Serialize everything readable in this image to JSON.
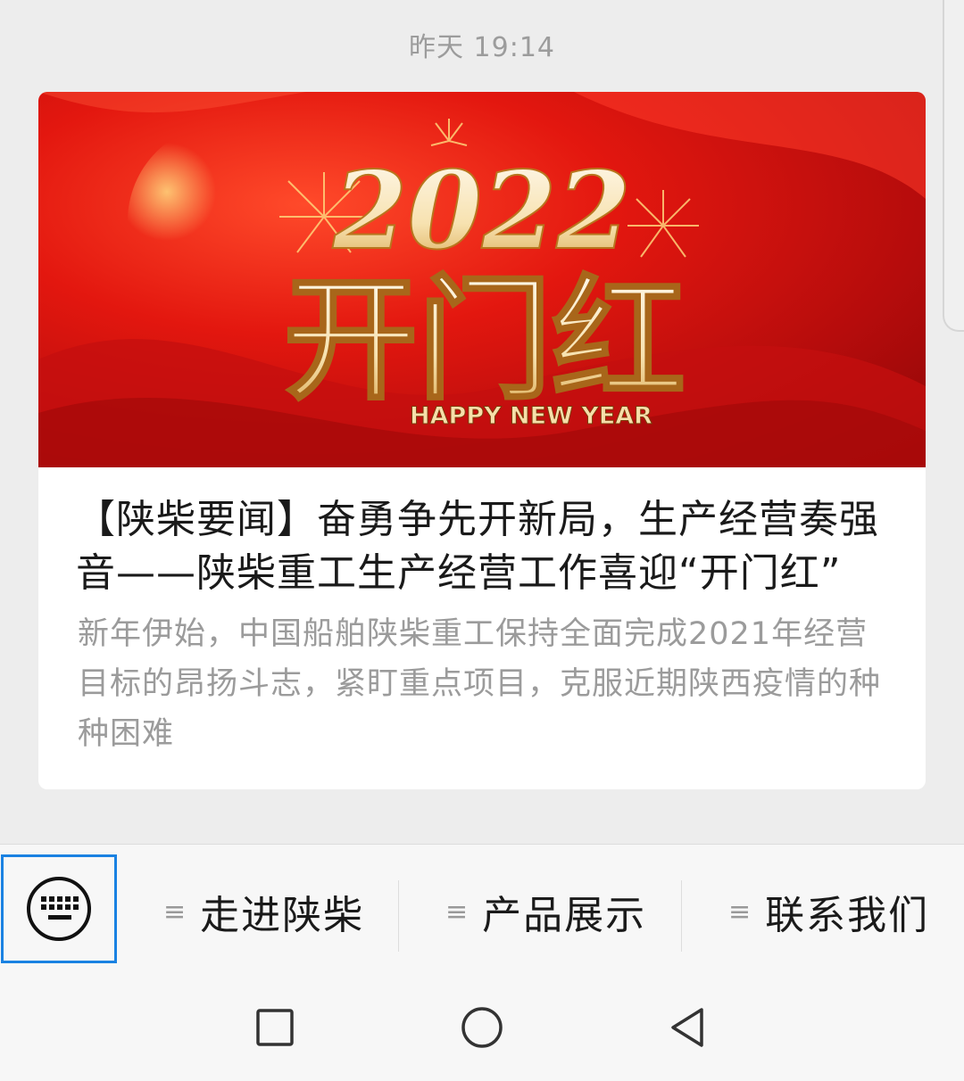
{
  "chat": {
    "timestamp": "昨天 19:14"
  },
  "article": {
    "cover": {
      "year": "2022",
      "slogan": "开门红",
      "subtitle": "HAPPY NEW YEAR"
    },
    "title": "【陕柴要闻】奋勇争先开新局，生产经营奏强音——陕柴重工生产经营工作喜迎“开门红”",
    "digest": "新年伊始，中国船舶陕柴重工保持全面完成2021年经营目标的昂扬斗志，紧盯重点项目，克服近期陕西疫情的种种困难"
  },
  "menu": {
    "keyboard_icon": "keyboard-icon",
    "items": [
      {
        "label": "走进陕柴",
        "icon": "menu-lines-icon"
      },
      {
        "label": "产品展示",
        "icon": "menu-lines-icon"
      },
      {
        "label": "联系我们",
        "icon": "menu-lines-icon"
      }
    ]
  },
  "navigation": {
    "buttons": [
      "recent-apps-icon",
      "home-icon",
      "back-icon"
    ]
  },
  "colors": {
    "accent": "#1a82e2",
    "cover_red": "#e3170f",
    "background": "#ededed"
  }
}
